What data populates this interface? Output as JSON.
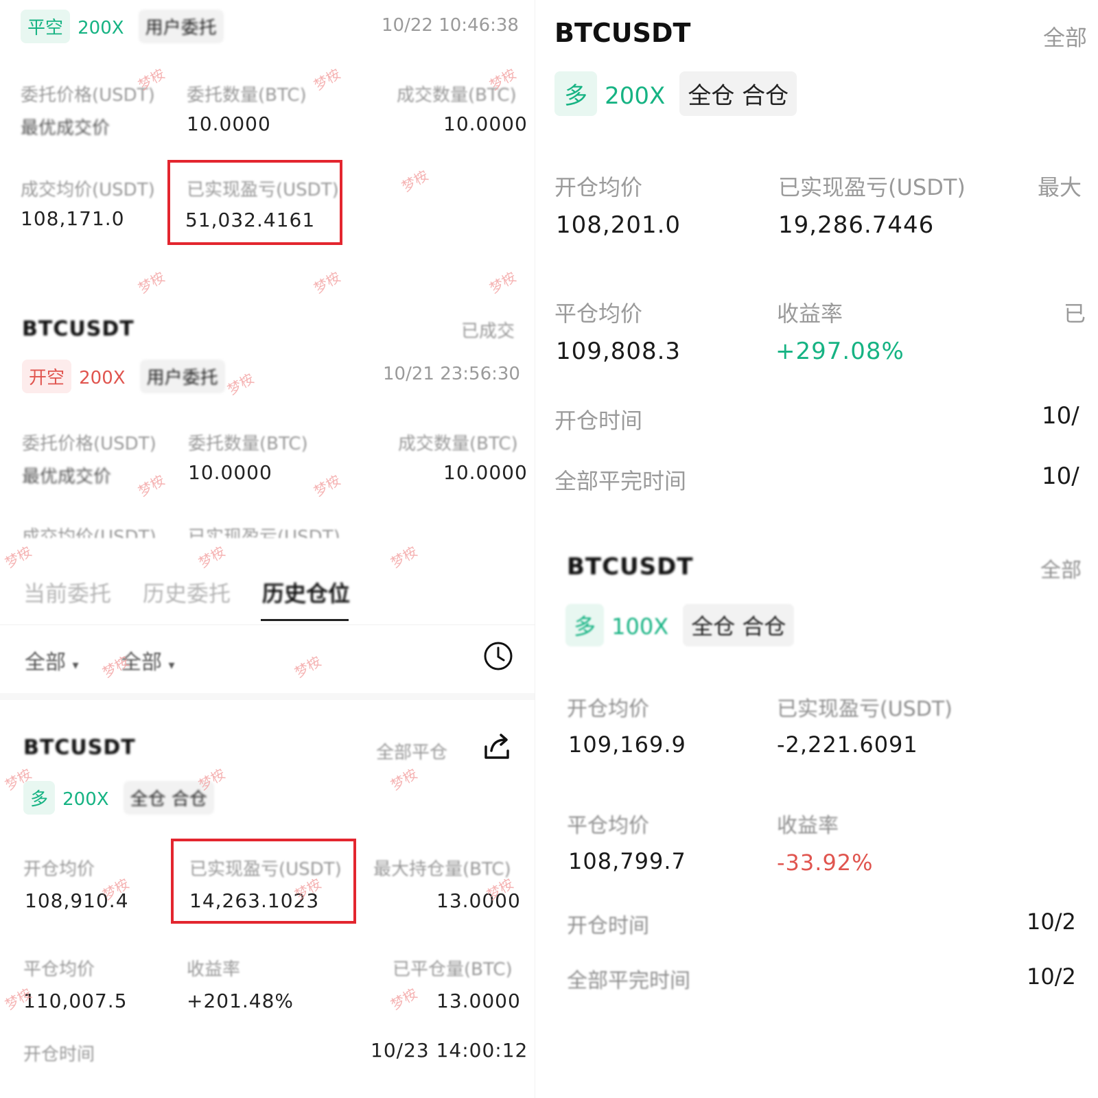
{
  "left": {
    "card1": {
      "tags": [
        "平空",
        "200X",
        "用户委托"
      ],
      "time": "10/22 10:46:38",
      "labels": [
        "委托价格(USDT)",
        "委托数量(BTC)",
        "成交数量(BTC)",
        "成交均价(USDT)",
        "已实现盈亏(USDT)"
      ],
      "order_price": "最优成交价",
      "order_qty": "10.0000",
      "filled_qty": "10.0000",
      "avg_price": "108,171.0",
      "realized_pnl": "51,032.4161"
    },
    "card2": {
      "symbol": "BTCUSDT",
      "status": "已成交",
      "tags": [
        "开空",
        "200X",
        "用户委托"
      ],
      "time": "10/21 23:56:30",
      "labels": [
        "委托价格(USDT)",
        "委托数量(BTC)",
        "成交数量(BTC)",
        "成交均价(USDT)",
        "已实现盈亏(USDT)"
      ],
      "order_price": "最优成交价",
      "order_qty": "10.0000",
      "filled_qty": "10.0000"
    },
    "tabs": [
      "当前委托",
      "历史委托",
      "历史仓位"
    ],
    "filters": [
      "全部",
      "全部"
    ],
    "card3": {
      "symbol": "BTCUSDT",
      "close_all": "全部平仓",
      "tags": [
        "多",
        "200X",
        "全仓 合仓"
      ],
      "labels": [
        "开仓均价",
        "已实现盈亏(USDT)",
        "最大持仓量(BTC)",
        "平仓均价",
        "收益率",
        "已平仓量(BTC)",
        "开仓时间"
      ],
      "open_avg": "108,910.4",
      "realized_pnl": "14,263.1023",
      "max_pos": "13.0000",
      "close_avg": "110,007.5",
      "roi": "+201.48%",
      "closed_qty": "13.0000",
      "open_time": "10/23 14:00:12"
    }
  },
  "right": {
    "card1": {
      "symbol": "BTCUSDT",
      "top_right": "全部",
      "tags": [
        "多",
        "200X",
        "全仓 合仓"
      ],
      "labels": [
        "开仓均价",
        "已实现盈亏(USDT)",
        "最大",
        "平仓均价",
        "收益率",
        "已",
        "开仓时间",
        "全部平完时间"
      ],
      "open_avg": "108,201.0",
      "realized_pnl": "19,286.7446",
      "close_avg": "109,808.3",
      "roi": "+297.08%",
      "open_time": "10/",
      "close_time": "10/"
    },
    "card2": {
      "symbol": "BTCUSDT",
      "top_right": "全部",
      "tags": [
        "多",
        "100X",
        "全仓 合仓"
      ],
      "labels": [
        "开仓均价",
        "已实现盈亏(USDT)",
        "平仓均价",
        "收益率",
        "开仓时间",
        "全部平完时间"
      ],
      "open_avg": "109,169.9",
      "realized_pnl": "-2,221.6091",
      "close_avg": "108,799.7",
      "roi": "-33.92%",
      "open_time": "10/2",
      "close_time": "10/2"
    }
  },
  "watermark": "梦桉",
  "colors": {
    "green": "#16b383",
    "red": "#e0554f",
    "highlight": "#e3262f"
  }
}
